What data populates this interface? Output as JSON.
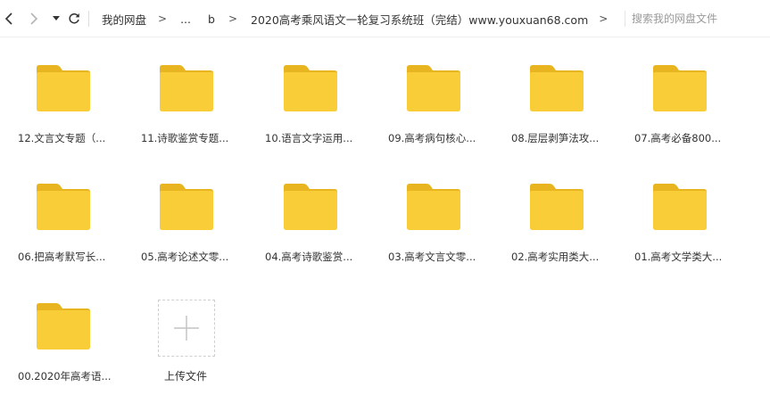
{
  "toolbar": {
    "back_icon": "chevron-left-icon",
    "forward_icon": "chevron-right-icon",
    "dropdown_icon": "caret-down-icon",
    "refresh_icon": "refresh-icon"
  },
  "breadcrumb": {
    "items": [
      "我的网盘",
      "...",
      "b",
      "2020高考乘风语文一轮复习系统班（完结）www.youxuan68.com"
    ],
    "separator": ">"
  },
  "search": {
    "placeholder": "搜索我的网盘文件"
  },
  "folders": [
    {
      "label": "12.文言文专题（..."
    },
    {
      "label": "11.诗歌鉴赏专题..."
    },
    {
      "label": "10.语言文字运用..."
    },
    {
      "label": "09.高考病句核心..."
    },
    {
      "label": "08.层层剥笋法攻..."
    },
    {
      "label": "07.高考必备800..."
    },
    {
      "label": "06.把高考默写长..."
    },
    {
      "label": "05.高考论述文零..."
    },
    {
      "label": "04.高考诗歌鉴赏..."
    },
    {
      "label": "03.高考文言文零..."
    },
    {
      "label": "02.高考实用类大..."
    },
    {
      "label": "01.高考文学类大..."
    },
    {
      "label": "00.2020年高考语..."
    }
  ],
  "upload": {
    "label": "上传文件",
    "icon": "plus-icon"
  },
  "colors": {
    "folder_body": "#f9cd37",
    "folder_tab": "#e8b41f",
    "border": "#eeeeee"
  }
}
